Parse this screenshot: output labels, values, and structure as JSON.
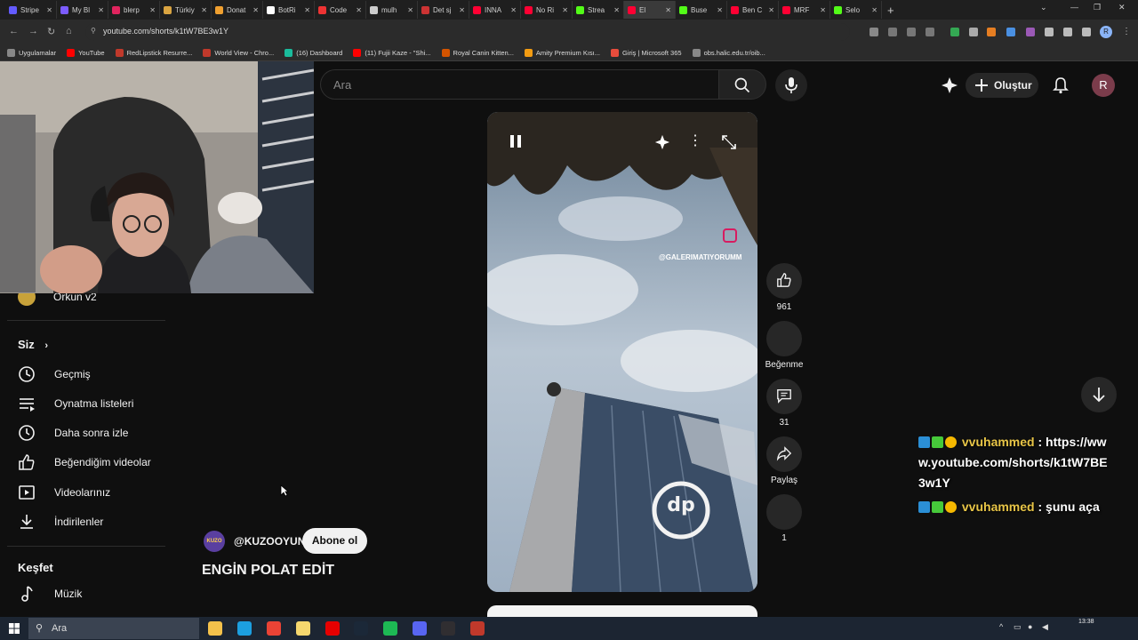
{
  "browser": {
    "tabs": [
      {
        "title": "Stripe",
        "color": "#635bff"
      },
      {
        "title": "My Bl",
        "color": "#7c5cff"
      },
      {
        "title": "blerp",
        "color": "#e0245e"
      },
      {
        "title": "Türkiy",
        "color": "#d9a441"
      },
      {
        "title": "Donat",
        "color": "#f0a030"
      },
      {
        "title": "BotRi",
        "color": "#ffffff"
      },
      {
        "title": "Code",
        "color": "#e33"
      },
      {
        "title": "mulh",
        "color": "#cccccc"
      },
      {
        "title": "Det sj",
        "color": "#c33"
      },
      {
        "title": "INNA",
        "color": "#ff0033"
      },
      {
        "title": "No Ri",
        "color": "#ff0033"
      },
      {
        "title": "Strea",
        "color": "#53fc18"
      },
      {
        "title": "El",
        "color": "#ff0033",
        "active": true
      },
      {
        "title": "Buse",
        "color": "#53fc18"
      },
      {
        "title": "Ben C",
        "color": "#ff0033"
      },
      {
        "title": "MRF",
        "color": "#ff0033"
      },
      {
        "title": "Selo",
        "color": "#53fc18"
      }
    ],
    "new_tab": "+",
    "url": "youtube.com/shorts/k1tW7BE3w1Y",
    "profile_initial": "R",
    "bookmarks": [
      {
        "label": "Uygulamalar",
        "color": "#888888"
      },
      {
        "label": "YouTube",
        "color": "#ff0000"
      },
      {
        "label": "RedLipstick Resurre...",
        "color": "#c0392b"
      },
      {
        "label": "World View - Chro...",
        "color": "#c0392b"
      },
      {
        "label": "(16) Dashboard",
        "color": "#1abc9c"
      },
      {
        "label": "(11) Fujii Kaze - \"Shi...",
        "color": "#ff0000"
      },
      {
        "label": "Royal Canin Kitten...",
        "color": "#d35400"
      },
      {
        "label": "Amity Premium Kısı...",
        "color": "#f39c12"
      },
      {
        "label": "Giriş | Microsoft 365",
        "color": "#e74c3c"
      },
      {
        "label": "obs.halic.edu.tr/oib...",
        "color": "#888888"
      }
    ]
  },
  "header": {
    "search_placeholder": "Ara",
    "create_label": "Oluştur",
    "avatar_initial": "R"
  },
  "sidebar": {
    "subscription_item": "Orkun v2",
    "you_section": "Siz",
    "you_items": [
      "Geçmiş",
      "Oynatma listeleri",
      "Daha sonra izle",
      "Beğendiğim videolar",
      "Videolarınız",
      "İndirilenler"
    ],
    "explore_section": "Keşfet",
    "explore_items": [
      "Müzik"
    ]
  },
  "video": {
    "watermark": "@GALERIMATIYORUMM",
    "building_logo": "dp"
  },
  "actions": {
    "like_count": "961",
    "dislike_label": "Beğenme",
    "comment_count": "31",
    "share_label": "Paylaş",
    "remix_count": "1"
  },
  "channel": {
    "avatar_text": "KUZO",
    "handle": "@KUZOOYUN",
    "subscribe_label": "Abone ol",
    "video_title": "ENGİN POLAT EDİT"
  },
  "chat": [
    {
      "user": "vvuhammed",
      "message": "https://www.youtube.com/shorts/k1tW7BE3w1Y"
    },
    {
      "user": "vvuhammed",
      "message": "şunu aça"
    }
  ],
  "taskbar": {
    "search_placeholder": "Ara",
    "time": "13:38",
    "apps": [
      {
        "name": "file-explorer",
        "color": "#f3c14b"
      },
      {
        "name": "edge",
        "color": "#1c9fe0"
      },
      {
        "name": "chrome",
        "color": "#ea4335"
      },
      {
        "name": "notes",
        "color": "#f5d76e"
      },
      {
        "name": "vodafone",
        "color": "#e60000"
      },
      {
        "name": "steam",
        "color": "#1b2838"
      },
      {
        "name": "spotify",
        "color": "#1db954"
      },
      {
        "name": "discord",
        "color": "#5865f2"
      },
      {
        "name": "obs",
        "color": "#302e31"
      },
      {
        "name": "recorder",
        "color": "#c0392b"
      }
    ]
  },
  "colors": {
    "background": "#0f0f0f",
    "surface": "#272727",
    "text": "#f1f1f1",
    "chat_username": "#e8c547"
  }
}
